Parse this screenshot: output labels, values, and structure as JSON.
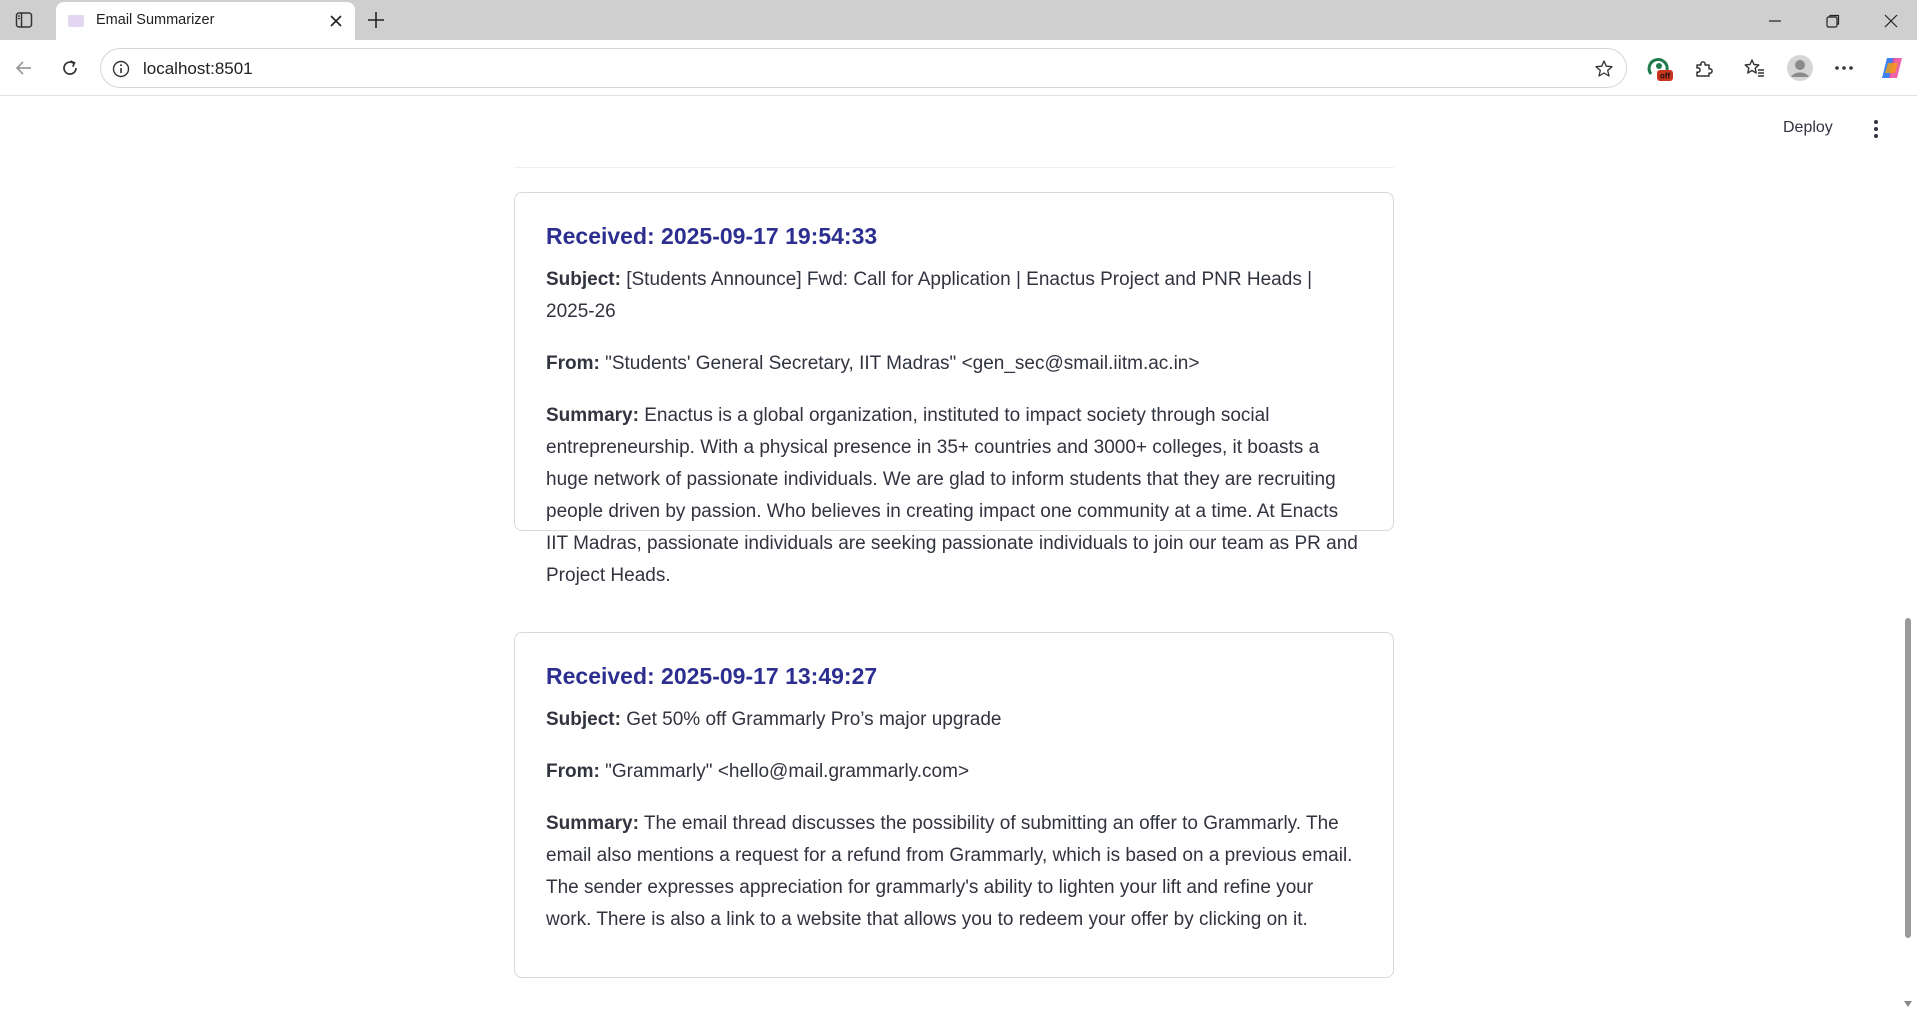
{
  "browser": {
    "tab_title": "Email Summarizer",
    "url": "localhost:8501",
    "extension_badge": "off"
  },
  "app": {
    "deploy_label": "Deploy"
  },
  "labels": {
    "subject": "Subject:",
    "from": "From:",
    "summary": "Summary:"
  },
  "emails": [
    {
      "received": "Received: 2025-09-17 19:54:33",
      "subject": "[Students Announce] Fwd: Call for Application | Enactus Project and PNR Heads | 2025-26",
      "from": "\"Students' General Secretary, IIT Madras\" <gen_sec@smail.iitm.ac.in>",
      "summary": "Enactus is a global organization, instituted to impact society through social entrepreneurship. With a physical presence in 35+ countries and 3000+ colleges, it boasts a huge network of passionate individuals. We are glad to inform students that they are recruiting people driven by passion. Who believes in creating impact one community at a time. At Enacts IIT Madras, passionate individuals are seeking passionate individuals to join our team as PR and Project Heads."
    },
    {
      "received": "Received: 2025-09-17 13:49:27",
      "subject": "Get 50% off Grammarly Pro’s major upgrade",
      "from": "\"Grammarly\" <hello@mail.grammarly.com>",
      "summary": "The email thread discusses the possibility of submitting an offer to Grammarly. The email also mentions a request for a refund from Grammarly, which is based on a previous email. The sender expresses appreciation for grammarly's ability to lighten your lift and refine your work. There is also a link to a website that allows you to redeem your offer by clicking on it."
    }
  ]
}
